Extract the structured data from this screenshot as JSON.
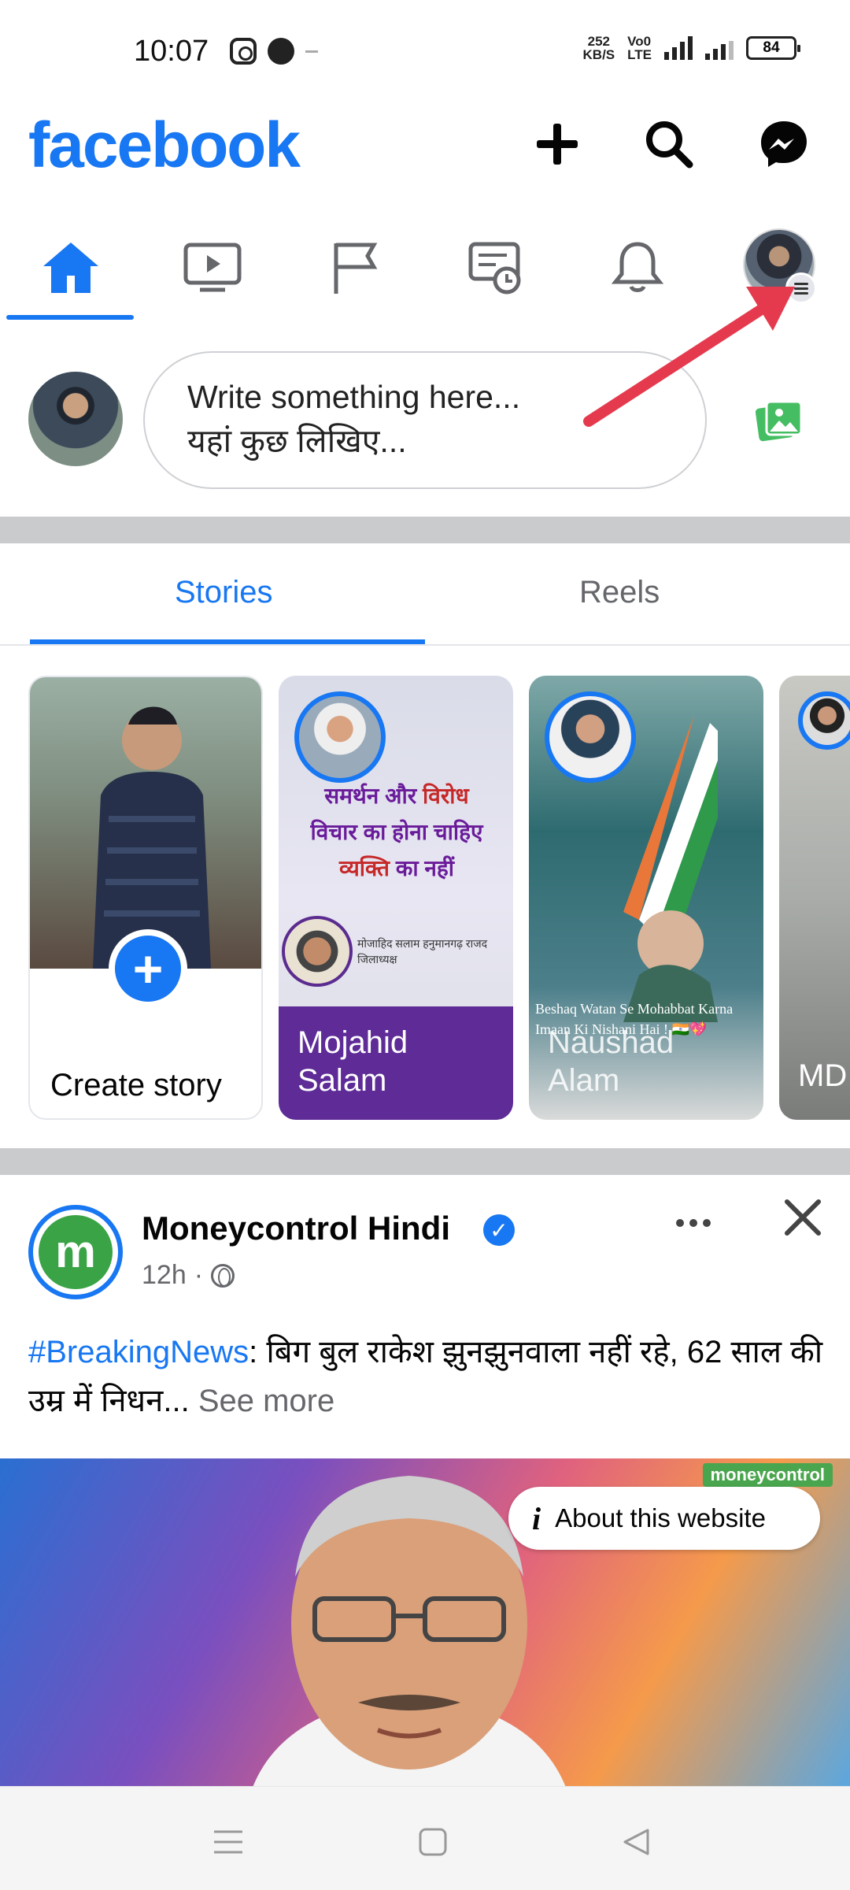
{
  "status_bar": {
    "time": "10:07",
    "speed_value": "252",
    "speed_unit": "KB/S",
    "volte_top": "Vo0",
    "volte_bottom": "LTE",
    "network": "4G",
    "battery": "84"
  },
  "header": {
    "logo": "facebook",
    "icons": [
      "plus-icon",
      "search-icon",
      "messenger-icon"
    ]
  },
  "nav_tabs": [
    {
      "name": "home",
      "active": true
    },
    {
      "name": "watch",
      "active": false
    },
    {
      "name": "pages",
      "active": false
    },
    {
      "name": "memories",
      "active": false
    },
    {
      "name": "notifications",
      "active": false
    },
    {
      "name": "menu",
      "active": false
    }
  ],
  "composer": {
    "placeholder_line1": "Write something here...",
    "placeholder_line2": "यहां कुछ लिखिए..."
  },
  "story_tabs": {
    "active": "Stories",
    "inactive": "Reels"
  },
  "stories": {
    "create_label": "Create story",
    "card2": {
      "name": "Mojahid\nSalam",
      "poster_line1_a": "समर्थन और",
      "poster_line1_b": "विरोध",
      "poster_line2": "विचार का होना चाहिए",
      "poster_line3_a": "व्यक्ति",
      "poster_line3_b": "का नहीं",
      "caption": "मोजाहिद सलाम हनुमानगढ़ राजद जिलाध्यक्ष"
    },
    "card3": {
      "name": "Naushad\nAlam",
      "quote": "Beshaq Watan Se Mohabbat Karna Imaan Ki Nishani Hai ! 🇮🇳💖"
    },
    "card4": {
      "name": "MD"
    }
  },
  "post": {
    "author": "Moneycontrol Hindi",
    "logo_letter": "m",
    "time": "12h",
    "separator": "·",
    "hashtag": "#BreakingNews",
    "text": ": बिग बुल राकेश झुनझुनवाला नहीं रहे, 62 साल की उम्र में निधन...",
    "see_more": "See more",
    "image_brand": "moneycontrol",
    "about_label": "About this website",
    "about_icon": "i"
  },
  "colors": {
    "brand_blue": "#1877f2",
    "arrow_red": "#e53a4e",
    "story_purple": "#5e2b97"
  }
}
